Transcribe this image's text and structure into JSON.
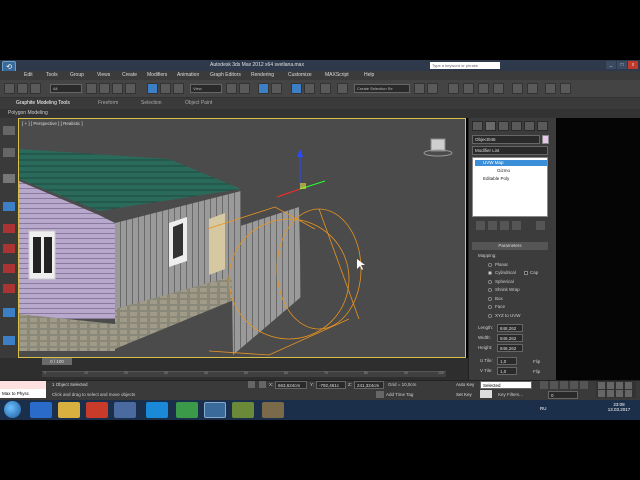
{
  "title_bar": {
    "title": "Autodesk 3ds Max 2012 x64     svetlana.max",
    "search_placeholder": "Type a keyword or phrase",
    "minimize": "_",
    "maximize": "□",
    "close": "x"
  },
  "menu": {
    "items": [
      "Edit",
      "Tools",
      "Group",
      "Views",
      "Create",
      "Modifiers",
      "Animation",
      "Graph Editors",
      "Rendering",
      "Customize",
      "MAXScript",
      "Help"
    ]
  },
  "toolbar": {
    "selection_filter": "All",
    "reference_coord": "View",
    "named_selection": "Create Selection Se"
  },
  "ribbon": {
    "tabs": [
      "Graphite Modeling Tools",
      "Freeform",
      "Selection",
      "Object Paint"
    ],
    "sub_label": "Polygon Modeling"
  },
  "viewport": {
    "label": "[ + ] [ Perspective ] [ Realistic ]"
  },
  "command_panel": {
    "object_name": "Object046",
    "modifier_list": "Modifier List",
    "stack": [
      {
        "label": "UVW Map",
        "selected": true
      },
      {
        "label": "Gizmo",
        "selected": false
      },
      {
        "label": "Editable Poly",
        "selected": false
      }
    ],
    "parameters_title": "Parameters",
    "mapping_label": "Mapping:",
    "mapping_options": [
      "Planar",
      "Cylindrical",
      "Spherical",
      "Shrink Wrap",
      "Box",
      "Face",
      "XYZ to UVW"
    ],
    "cap_label": "Cap",
    "length_label": "Length:",
    "length_value": "848,262",
    "width_label": "Width:",
    "width_value": "848,262",
    "height_label": "Height:",
    "height_value": "848,262",
    "utile_label": "U Tile:",
    "utile_value": "1,0",
    "vtile_label": "V Tile:",
    "vtile_value": "1,0",
    "flip_label": "Flip"
  },
  "timeline": {
    "slider": "0 / 100",
    "ticks": [
      "0",
      "10",
      "20",
      "30",
      "40",
      "50",
      "60",
      "70",
      "80",
      "90",
      "100"
    ]
  },
  "status": {
    "maxscript": "Max to Physc",
    "selected_count": "1 Object Selected",
    "prompt": "Click and drag to select and move objects",
    "x_label": "X:",
    "x_value": "663,624cm",
    "y_label": "Y:",
    "y_value": "-792,461c",
    "z_label": "Z:",
    "z_value": "241,324cm",
    "grid": "Grid = 10,0cm",
    "auto_key": "Auto Key",
    "key_mode": "Selected",
    "set_key": "Set Key",
    "key_filters": "Key Filters...",
    "add_time_tag": "Add Time Tag",
    "frame": "0"
  },
  "taskbar": {
    "lang": "RU",
    "time": "23:08",
    "date": "13.03.2017"
  }
}
